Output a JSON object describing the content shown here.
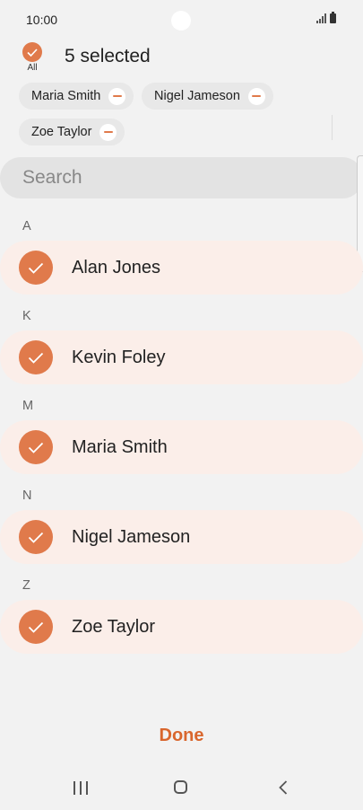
{
  "status_bar": {
    "time": "10:00",
    "icons": [
      "signal-icon",
      "battery-icon"
    ]
  },
  "header": {
    "all_label": "All",
    "selected_count": "5 selected"
  },
  "chips": [
    {
      "label": "Maria Smith"
    },
    {
      "label": "Nigel Jameson"
    },
    {
      "label": "Zoe Taylor"
    }
  ],
  "search": {
    "placeholder": "Search"
  },
  "sections": [
    {
      "letter": "A",
      "contacts": [
        {
          "name": "Alan Jones",
          "selected": true
        }
      ]
    },
    {
      "letter": "K",
      "contacts": [
        {
          "name": "Kevin Foley",
          "selected": true
        }
      ]
    },
    {
      "letter": "M",
      "contacts": [
        {
          "name": "Maria Smith",
          "selected": true
        }
      ]
    },
    {
      "letter": "N",
      "contacts": [
        {
          "name": "Nigel Jameson",
          "selected": true
        }
      ]
    },
    {
      "letter": "Z",
      "contacts": [
        {
          "name": "Zoe Taylor",
          "selected": true
        }
      ]
    }
  ],
  "footer": {
    "done_label": "Done"
  },
  "nav_bar": {
    "buttons": [
      "recent-apps-icon",
      "home-icon",
      "back-icon"
    ]
  },
  "colors": {
    "accent": "#e07a4b",
    "done": "#d9662d",
    "row_bg": "#fbeee9",
    "background": "#f2f2f2"
  }
}
